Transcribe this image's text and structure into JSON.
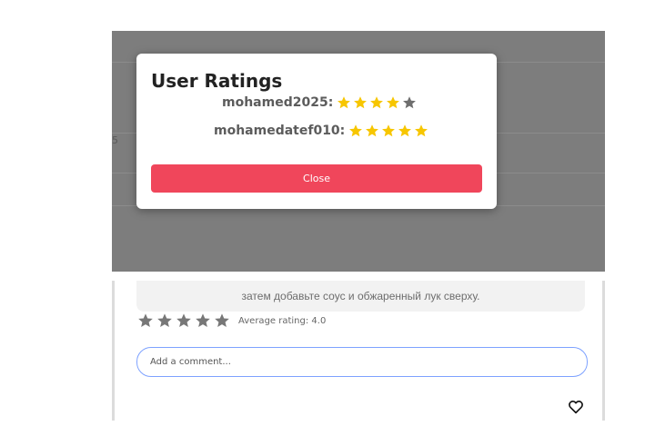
{
  "background_page": {
    "partial_text": "5"
  },
  "modal": {
    "title": "User Ratings",
    "ratings": [
      {
        "username": "mohamed2025:",
        "stars": 4,
        "max": 5
      },
      {
        "username": "mohamedatef010:",
        "stars": 5,
        "max": 5
      }
    ],
    "close_label": "Close"
  },
  "card": {
    "description": "затем добавьте соус и обжаренный лук сверху.",
    "rating_stars_count": 5,
    "average_rating_text": "Average rating: 4.0",
    "comment_placeholder": "Add a comment...",
    "like_icon": "heart-icon"
  },
  "colors": {
    "star_filled": "#f7c600",
    "star_empty": "#6e6e6e",
    "close_button": "#f0465b",
    "overlay": "#7d7d7d",
    "input_border": "#7ea2ff"
  }
}
